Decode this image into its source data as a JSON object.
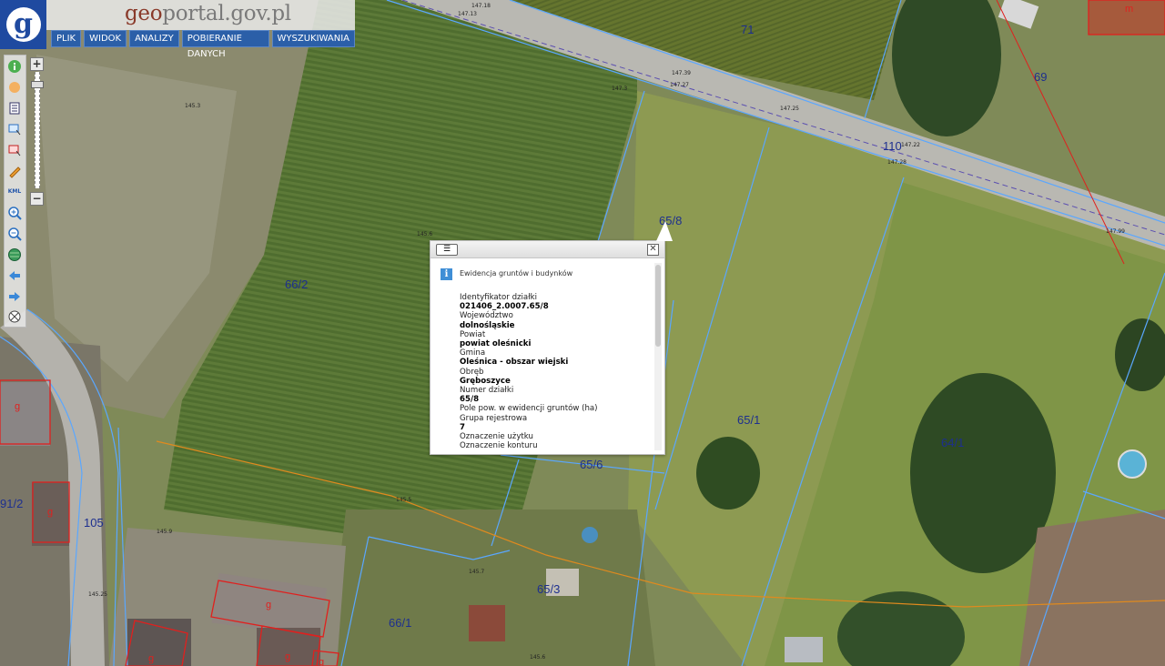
{
  "app": {
    "logo_letter": "g",
    "site_title_prefix": "geo",
    "site_title_rest": "portal.gov.pl",
    "menu": [
      "PLIK",
      "WIDOK",
      "ANALIZY",
      "POBIERANIE DANYCH",
      "WYSZUKIWANIA"
    ]
  },
  "toolbar": {
    "tools": [
      "info-icon",
      "pan-hand-icon",
      "layers-list-icon",
      "select-rect-icon",
      "select-area-icon",
      "pencil-icon",
      "kml-icon",
      "zoom-in-icon",
      "zoom-out-icon",
      "globe-icon",
      "arrow-back-icon",
      "arrow-forward-icon",
      "clear-icon"
    ],
    "kml_label": "KML"
  },
  "zoom": {
    "plus": "+",
    "minus": "−"
  },
  "map": {
    "parcels": [
      "71",
      "69",
      "110",
      "65/8",
      "66/2",
      "65/1",
      "64/1",
      "65/6",
      "65/3",
      "66/1",
      "105",
      "91/2"
    ],
    "building_marks": [
      "m",
      "g",
      "g",
      "g",
      "g",
      "g",
      "g"
    ],
    "elevations": [
      "147.18",
      "147.13",
      "147.39",
      "147.27",
      "147.3",
      "147.25",
      "147.22",
      "147.28",
      "147.99",
      "145.3",
      "145.6",
      "145.5",
      "145.9",
      "145.25",
      "145.6",
      "145.7"
    ],
    "colors": {
      "parcel_line": "#5aa7ff",
      "utility_line": "#e08a1e",
      "building_outline": "#e0201e",
      "label": "#1d2f8f"
    }
  },
  "popup": {
    "section_title": "Ewidencja gruntów i budynków",
    "fields": [
      {
        "label": "Identyfikator działki",
        "value": "021406_2.0007.65/8"
      },
      {
        "label": "Województwo",
        "value": "dolnośląskie"
      },
      {
        "label": "Powiat",
        "value": "powiat oleśnicki"
      },
      {
        "label": "Gmina",
        "value": "Oleśnica - obszar wiejski"
      },
      {
        "label": "Obręb",
        "value": "Gręboszyce"
      },
      {
        "label": "Numer działki",
        "value": "65/8"
      },
      {
        "label": "Pole pow. w ewidencji gruntów (ha)",
        "value": ""
      },
      {
        "label": "Grupa rejestrowa",
        "value": "7"
      },
      {
        "label": "Oznaczenie użytku",
        "value": ""
      },
      {
        "label": "Oznaczenie konturu",
        "value": ""
      }
    ]
  }
}
